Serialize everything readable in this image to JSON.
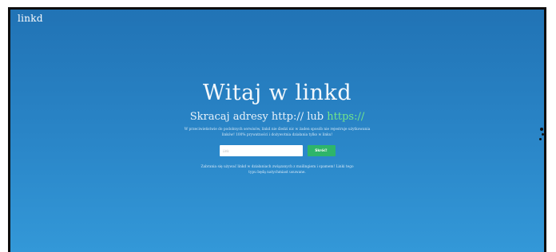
{
  "app": {
    "logo": "linkd"
  },
  "hero": {
    "title": "Witaj w linkd",
    "subtitle_prefix": "Skracaj adresy http:// lub ",
    "subtitle_highlight": "https://",
    "description": "W przeciwieństwie do podobnych serwisów, linkd nie śledzi nic w żaden sposób nie rejestruje użytkowania linków! 100% prywatności i dożywotnia działania tylko w linku!"
  },
  "form": {
    "url_placeholder": "Link",
    "shorten_label": "Skróć!"
  },
  "notice": "Zabrania się używać linkd w działaniach związanych z mailingiem i spamem! Linki tego typu będą natychmiast usuwane.",
  "colors": {
    "background_top": "#2173b5",
    "background_bottom": "#3398d8",
    "accent_green": "#2eb56a",
    "https_green": "#72e58a"
  }
}
